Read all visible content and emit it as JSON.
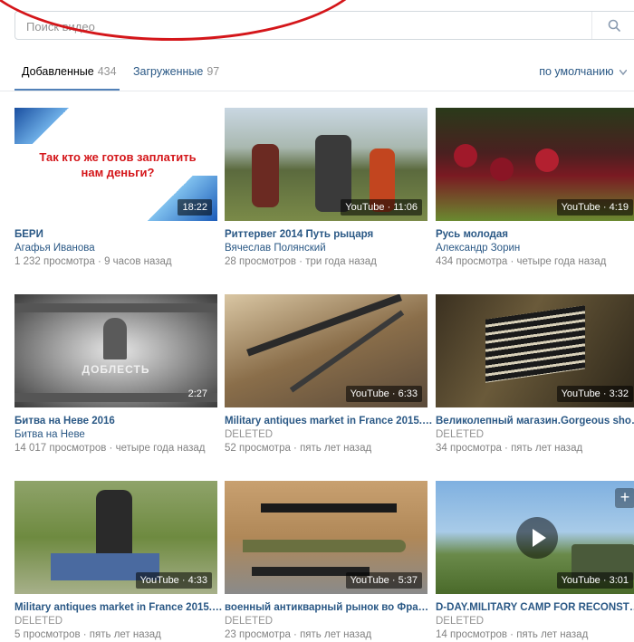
{
  "search": {
    "placeholder": "Поиск видео"
  },
  "tabs": [
    {
      "label": "Добавленные",
      "count": "434"
    },
    {
      "label": "Загруженные",
      "count": "97"
    }
  ],
  "sort": {
    "label": "по умолчанию"
  },
  "videos": [
    {
      "title": "БЕРИ",
      "author": "Агафья Иванова",
      "meta": "1 232 просмотра · 9 часов назад",
      "duration": "18:22",
      "thumb_text": "Так кто же готов заплатить нам деньги?"
    },
    {
      "title": "Риттервег 2014 Путь рыцаря",
      "author": "Вячеслав Полянский",
      "meta": "28 просмотров · три года назад",
      "duration": "YouTube · 11:06"
    },
    {
      "title": "Русь молодая",
      "author": "Александр Зорин",
      "meta": "434 просмотра · четыре года назад",
      "duration": "YouTube · 4:19"
    },
    {
      "title": "Битва на Неве 2016",
      "author": "Битва на Неве",
      "meta": "14 017 просмотров · четыре года назад",
      "duration": "2:27",
      "thumb_text": "ДОБЛЕСТЬ"
    },
    {
      "title": "Military antiques market in France 2015.в...",
      "author": "DELETED",
      "meta": "52 просмотра · пять лет назад",
      "duration": "YouTube · 6:33"
    },
    {
      "title": "Великолепный магазин.Gorgeous shop)))",
      "author": "DELETED",
      "meta": "34 просмотра · пять лет назад",
      "duration": "YouTube · 3:32"
    },
    {
      "title": "Military antiques market in France 2015.в...",
      "author": "DELETED",
      "meta": "5 просмотров · пять лет назад",
      "duration": "YouTube · 4:33"
    },
    {
      "title": "военный антикварный рынок во Фран...",
      "author": "DELETED",
      "meta": "23 просмотра · пять лет назад",
      "duration": "YouTube · 5:37"
    },
    {
      "title": "D-DAY.MILITARY CAMP FOR RECONSTR...",
      "author": "DELETED",
      "meta": "14 просмотров · пять лет назад",
      "duration": "YouTube · 3:01"
    }
  ],
  "colors": {
    "link": "#2a5885",
    "muted": "#828282",
    "accent": "#5181b8",
    "annotation": "#d4161a"
  },
  "icons": {
    "search": "magnifier",
    "sort": "chevron-down",
    "add": "plus",
    "play": "play-triangle"
  }
}
